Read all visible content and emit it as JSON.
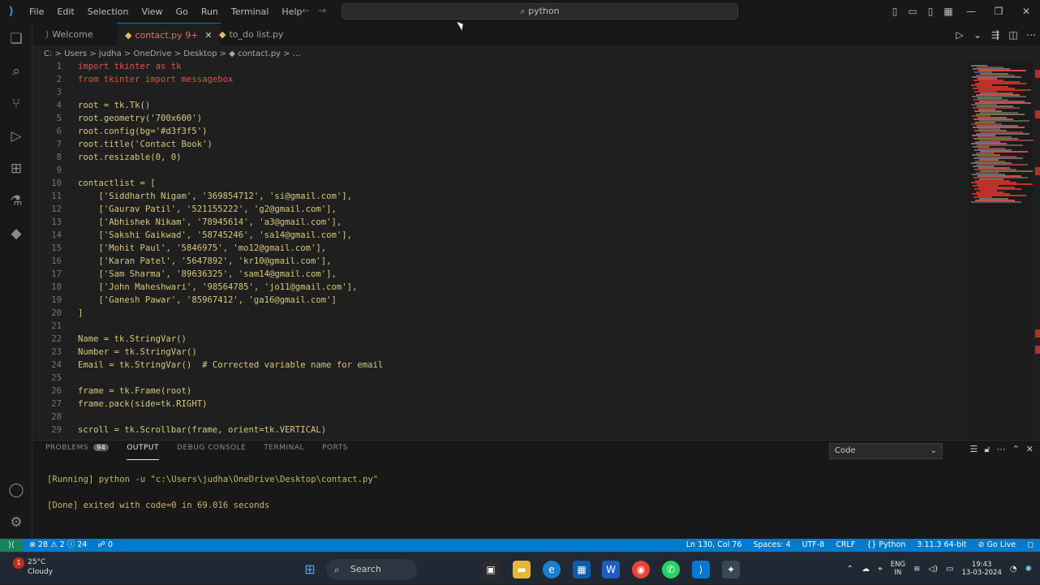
{
  "window": {
    "menu": [
      "File",
      "Edit",
      "Selection",
      "View",
      "Go",
      "Run",
      "Terminal",
      "Help"
    ],
    "search_text": "python"
  },
  "tabs": [
    {
      "label": "Welcome",
      "icon": "vscode-logo-icon"
    },
    {
      "label": "contact.py 9+",
      "icon": "python-file-icon",
      "active": true
    },
    {
      "label": "to_do list.py",
      "icon": "python-file-icon"
    }
  ],
  "breadcrumb": "C: > Users > judha > OneDrive > Desktop > ◆ contact.py > ...",
  "code_lines": [
    {
      "n": "1",
      "t": "import tkinter as tk",
      "c": "red"
    },
    {
      "n": "2",
      "t": "from tkinter import messagebox",
      "c": "red"
    },
    {
      "n": "3",
      "t": ""
    },
    {
      "n": "4",
      "t": "root = tk.Tk()"
    },
    {
      "n": "5",
      "t": "root.geometry('700x600')"
    },
    {
      "n": "6",
      "t": "root.config(bg='#d3f3f5')"
    },
    {
      "n": "7",
      "t": "root.title('Contact Book')"
    },
    {
      "n": "8",
      "t": "root.resizable(0, 0)"
    },
    {
      "n": "9",
      "t": ""
    },
    {
      "n": "10",
      "t": "contactlist = ["
    },
    {
      "n": "11",
      "t": "    ['Siddharth Nigam', '369854712', 'si@gmail.com'],"
    },
    {
      "n": "12",
      "t": "    ['Gaurav Patil', '521155222', 'g2@gmail.com'],"
    },
    {
      "n": "13",
      "t": "    ['Abhishek Nikam', '78945614', 'a3@gmail.com'],"
    },
    {
      "n": "14",
      "t": "    ['Sakshi Gaikwad', '58745246', 'sa14@gmail.com'],"
    },
    {
      "n": "15",
      "t": "    ['Mohit Paul', '5846975', 'mo12@gmail.com'],"
    },
    {
      "n": "16",
      "t": "    ['Karan Patel', '5647892', 'kr10@gmail.com'],"
    },
    {
      "n": "17",
      "t": "    ['Sam Sharma', '89636325', 'sam14@gmail.com'],"
    },
    {
      "n": "18",
      "t": "    ['John Maheshwari', '98564785', 'jo11@gmail.com'],"
    },
    {
      "n": "19",
      "t": "    ['Ganesh Pawar', '85967412', 'ga16@gmail.com']"
    },
    {
      "n": "20",
      "t": "]"
    },
    {
      "n": "21",
      "t": ""
    },
    {
      "n": "22",
      "t": "Name = tk.StringVar()"
    },
    {
      "n": "23",
      "t": "Number = tk.StringVar()"
    },
    {
      "n": "24",
      "t": "Email = tk.StringVar()  # Corrected variable name for email"
    },
    {
      "n": "25",
      "t": ""
    },
    {
      "n": "26",
      "t": "frame = tk.Frame(root)"
    },
    {
      "n": "27",
      "t": "frame.pack(side=tk.RIGHT)"
    },
    {
      "n": "28",
      "t": ""
    },
    {
      "n": "29",
      "t": "scroll = tk.Scrollbar(frame, orient=tk.VERTICAL)"
    }
  ],
  "panel": {
    "tabs": [
      "PROBLEMS",
      "OUTPUT",
      "DEBUG CONSOLE",
      "TERMINAL",
      "PORTS"
    ],
    "problems_count": "94",
    "filter_value": "Code",
    "output": [
      "[Running] python -u \"c:\\Users\\judha\\OneDrive\\Desktop\\contact.py\"",
      "",
      "[Done] exited with code=0 in 69.016 seconds"
    ]
  },
  "status": {
    "left": [
      "⊗ 28 ⚠ 2 ⓘ 24",
      "☍ 0"
    ],
    "right": [
      "Ln 130, Col 76",
      "Spaces: 4",
      "UTF-8",
      "CRLF",
      "{} Python",
      "3.11.3 64-bit",
      "⊘ Go Live"
    ]
  },
  "taskbar": {
    "weather_temp": "25°C",
    "weather_desc": "Cloudy",
    "weather_badge": "1",
    "search_label": "Search",
    "lang_top": "ENG",
    "lang_bottom": "IN",
    "time": "19:43",
    "date": "13-03-2024"
  }
}
